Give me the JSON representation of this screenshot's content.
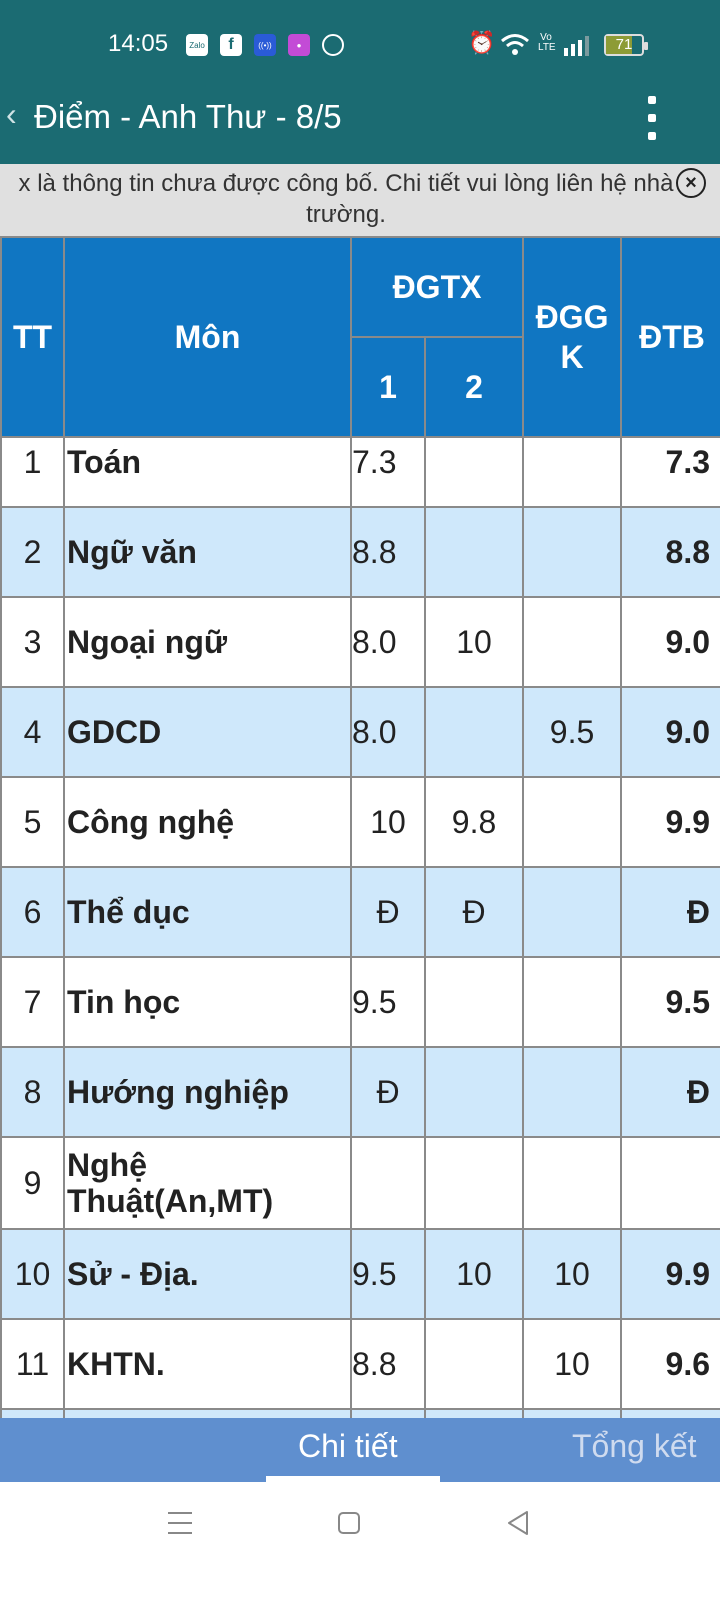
{
  "status_bar": {
    "time": "14:05",
    "notification_icons": [
      "zalo-icon",
      "facebook-icon",
      "hotspot-icon",
      "game-app-icon",
      "compass-icon"
    ],
    "system_icons": [
      "alarm-icon",
      "wifi-icon",
      "volte-icon",
      "signal-icon"
    ],
    "battery": "71",
    "zalo_label": "Zalo",
    "fb_label": "f",
    "volte_label": "Vo LTE"
  },
  "app_bar": {
    "back_glyph": "‹",
    "title": "Điểm - Anh Thư - 8/5"
  },
  "notice": {
    "text": "x là thông tin chưa được công bố. Chi tiết vui lòng liên hệ nhà trường.",
    "close_glyph": "×"
  },
  "table": {
    "headers": {
      "tt": "TT",
      "mon": "Môn",
      "dgtx": "ĐGTX",
      "dgtx_1": "1",
      "dgtx_2": "2",
      "dggk": "ĐGG K",
      "dtb": "ĐTB"
    },
    "rows": [
      {
        "tt": "1",
        "mon": "Toán",
        "g1": "7.3",
        "g2": "",
        "dggk": "",
        "dtb": "7.3"
      },
      {
        "tt": "2",
        "mon": "Ngữ văn",
        "g1": "8.8",
        "g2": "",
        "dggk": "",
        "dtb": "8.8"
      },
      {
        "tt": "3",
        "mon": "Ngoại ngữ",
        "g1": "8.0",
        "g2": "10",
        "dggk": "",
        "dtb": "9.0"
      },
      {
        "tt": "4",
        "mon": "GDCD",
        "g1": "8.0",
        "g2": "",
        "dggk": "9.5",
        "dtb": "9.0"
      },
      {
        "tt": "5",
        "mon": "Công nghệ",
        "g1": "10",
        "g2": "9.8",
        "dggk": "",
        "dtb": "9.9"
      },
      {
        "tt": "6",
        "mon": "Thể dục",
        "g1": "Đ",
        "g2": "Đ",
        "dggk": "",
        "dtb": "Đ"
      },
      {
        "tt": "7",
        "mon": "Tin học",
        "g1": "9.5",
        "g2": "",
        "dggk": "",
        "dtb": "9.5"
      },
      {
        "tt": "8",
        "mon": "Hướng nghiệp",
        "g1": "Đ",
        "g2": "",
        "dggk": "",
        "dtb": "Đ"
      },
      {
        "tt": "9",
        "mon": "Nghệ Thuật(An,MT)",
        "g1": "",
        "g2": "",
        "dggk": "",
        "dtb": ""
      },
      {
        "tt": "10",
        "mon": "Sử - Địa.",
        "g1": "9.5",
        "g2": "10",
        "dggk": "10",
        "dtb": "9.9"
      },
      {
        "tt": "11",
        "mon": "KHTN.",
        "g1": "8.8",
        "g2": "",
        "dggk": "10",
        "dtb": "9.6"
      }
    ]
  },
  "tabs": {
    "detail": "Chi tiết",
    "summary": "Tổng kết"
  }
}
